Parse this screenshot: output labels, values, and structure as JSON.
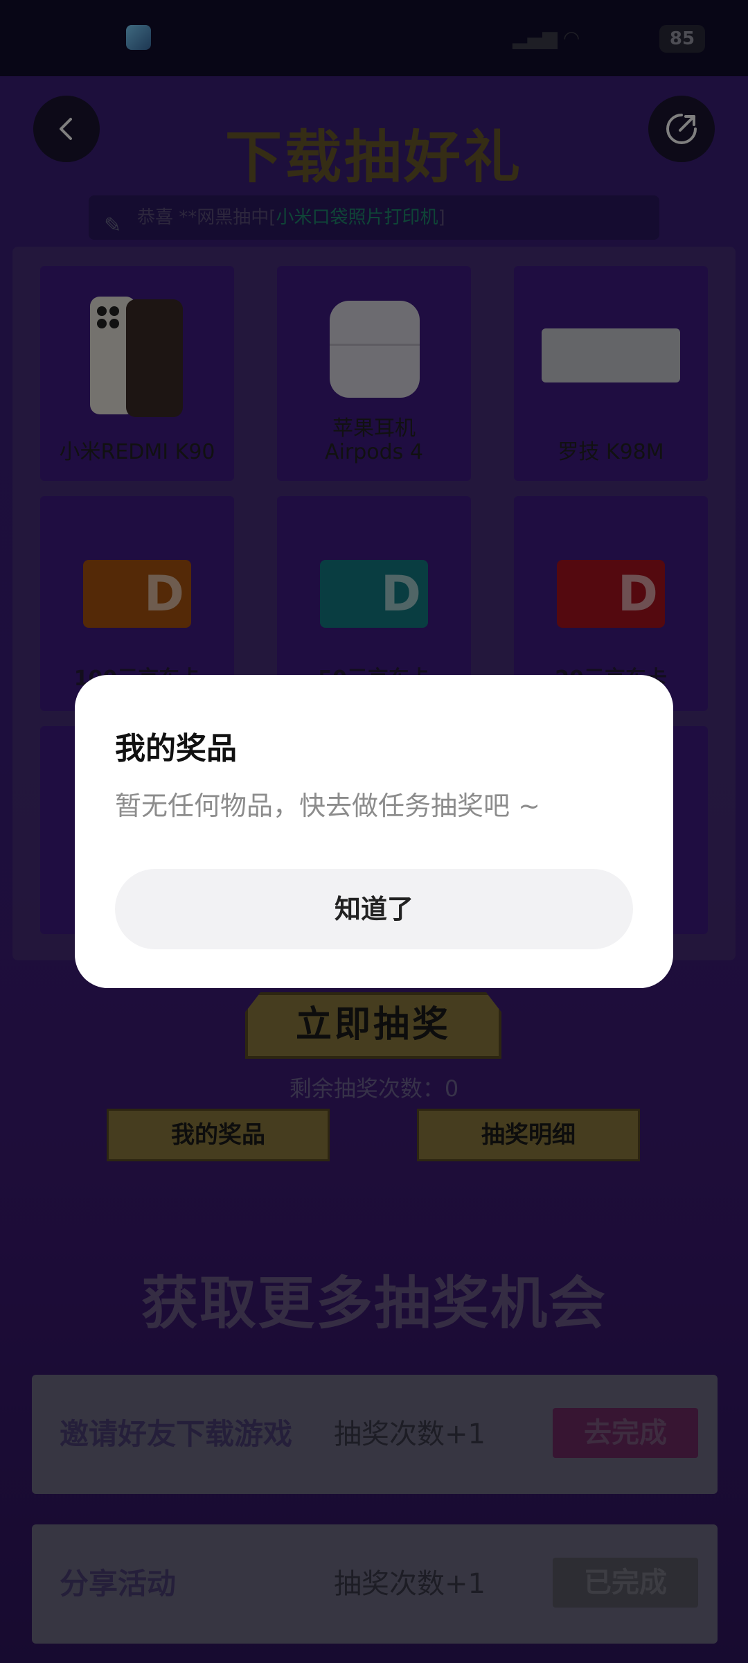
{
  "status_bar": {
    "battery": "85"
  },
  "header": {
    "title": "下载抽好礼"
  },
  "banner": {
    "prefix": "恭喜",
    "masked_user": "**网黑抽中[",
    "prize": "小米口袋照片打印机",
    "suffix": "]"
  },
  "prizes": [
    {
      "label": "小米REDMI K90"
    },
    {
      "label": "苹果耳机\nAirpods 4"
    },
    {
      "label": "罗技 K98M"
    },
    {
      "label": "100元京东卡"
    },
    {
      "label": "50元京东卡"
    },
    {
      "label": "20元京东卡"
    }
  ],
  "draw": {
    "button": "立即抽奖",
    "remaining": "剩余抽奖次数：0",
    "my_prizes_button": "我的奖品",
    "details_button": "抽奖明细"
  },
  "more_section": {
    "title": "获取更多抽奖机会"
  },
  "tasks": [
    {
      "name": "邀请好友下载游戏",
      "reward": "抽奖次数+1",
      "button": "去完成"
    },
    {
      "name": "分享活动",
      "reward": "抽奖次数+1",
      "button": "已完成"
    }
  ],
  "dialog": {
    "title": "我的奖品",
    "message": "暂无任何物品，快去做任务抽奖吧 ~",
    "button": "知道了"
  },
  "colors": {
    "page_bg": "#3a1f78",
    "gold": "#8c7b3f",
    "dialog_bg": "#ffffff",
    "dialog_button_bg": "#f2f2f4"
  }
}
